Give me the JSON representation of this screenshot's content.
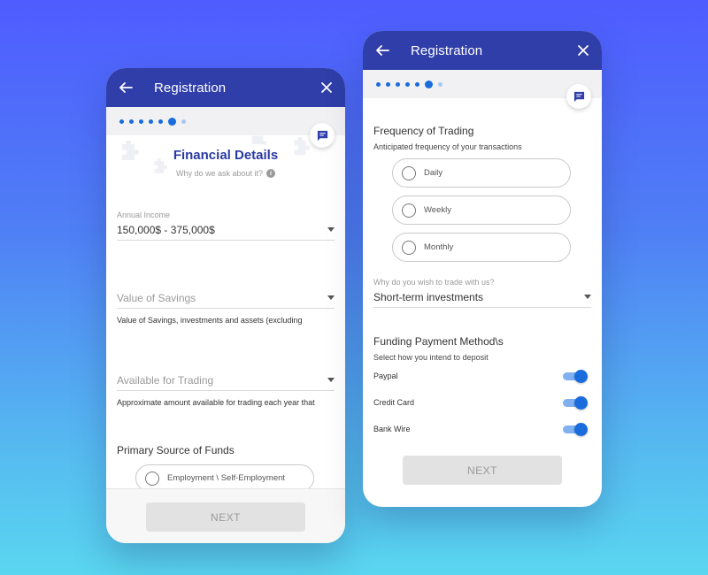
{
  "left": {
    "header": {
      "title": "Registration"
    },
    "page_title": "Financial Details",
    "why_ask": "Why do we ask about it?",
    "annual_income": {
      "label": "Annual Income",
      "value": "150,000$ - 375,000$"
    },
    "savings": {
      "placeholder": "Value of Savings",
      "helper": "Value of Savings, investments and assets (excluding"
    },
    "trading": {
      "placeholder": "Available for Trading",
      "helper": "Approximate amount available for trading each year that"
    },
    "primary_source": {
      "title": "Primary Source of Funds",
      "option": "Employment \\ Self-Employment"
    },
    "next_label": "NEXT"
  },
  "right": {
    "header": {
      "title": "Registration"
    },
    "frequency": {
      "title": "Frequency of Trading",
      "subtitle": "Anticipated frequency of your transactions",
      "options": [
        "Daily",
        "Weekly",
        "Monthly"
      ]
    },
    "why_trade": {
      "label": "Why do you wish to trade with us?",
      "value": "Short-term investments"
    },
    "funding": {
      "title": "Funding Payment Method\\s",
      "subtitle": "Select how you intend to deposit",
      "methods": [
        {
          "label": "Paypal",
          "enabled": true
        },
        {
          "label": "Credit Card",
          "enabled": true
        },
        {
          "label": "Bank Wire",
          "enabled": true
        }
      ]
    },
    "next_label": "NEXT"
  },
  "progress": {
    "steps_total": 7,
    "current_step": 6
  },
  "colors": {
    "header": "#2f3ea8",
    "accent": "#1a6bdc",
    "title_blue": "#2a3aa3"
  },
  "icons": [
    "back-arrow-icon",
    "close-icon",
    "chat-icon",
    "info-icon"
  ]
}
